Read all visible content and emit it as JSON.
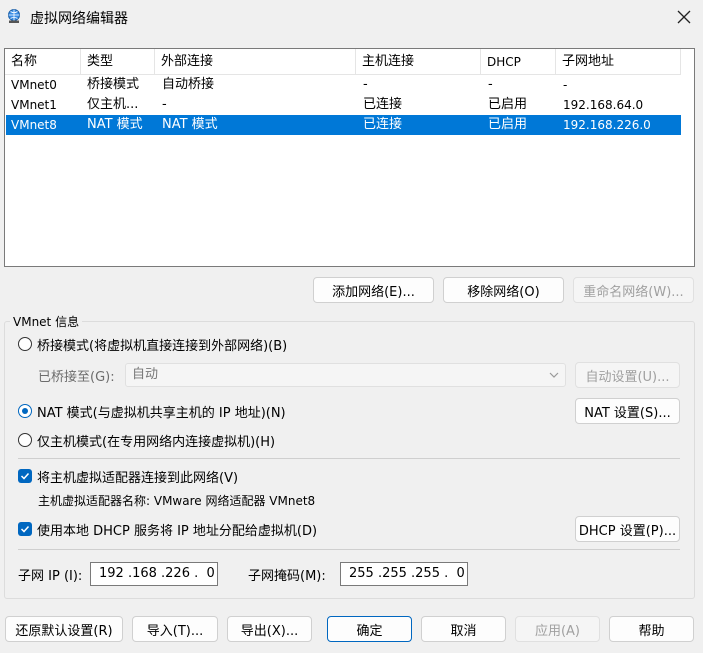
{
  "window": {
    "title": "虚拟网络编辑器",
    "icon": "network-globe-icon",
    "close_icon": "close-icon"
  },
  "table": {
    "columns": [
      "名称",
      "类型",
      "外部连接",
      "主机连接",
      "DHCP",
      "子网地址"
    ],
    "rows": [
      {
        "name": "VMnet0",
        "type": "桥接模式",
        "external": "自动桥接",
        "host": "-",
        "dhcp": "-",
        "subnet": "-",
        "selected": false
      },
      {
        "name": "VMnet1",
        "type": "仅主机...",
        "external": "-",
        "host": "已连接",
        "dhcp": "已启用",
        "subnet": "192.168.64.0",
        "selected": false
      },
      {
        "name": "VMnet8",
        "type": "NAT 模式",
        "external": "NAT 模式",
        "host": "已连接",
        "dhcp": "已启用",
        "subnet": "192.168.226.0",
        "selected": true
      }
    ]
  },
  "table_buttons": {
    "add": "添加网络(E)...",
    "remove": "移除网络(O)",
    "rename": "重命名网络(W)..."
  },
  "info": {
    "group_title": "VMnet 信息",
    "bridge_mode": "桥接模式(将虚拟机直接连接到外部网络)(B)",
    "bridged_to_label": "已桥接至(G):",
    "bridged_to_value": "自动",
    "auto_settings": "自动设置(U)...",
    "nat_mode": "NAT 模式(与虚拟机共享主机的 IP 地址)(N)",
    "nat_settings": "NAT 设置(S)...",
    "host_only": "仅主机模式(在专用网络内连接虚拟机)(H)",
    "connect_adapter": "将主机虚拟适配器连接到此网络(V)",
    "adapter_name": "主机虚拟适配器名称: VMware 网络适配器 VMnet8",
    "use_dhcp": "使用本地 DHCP 服务将 IP 地址分配给虚拟机(D)",
    "dhcp_settings": "DHCP 设置(P)...",
    "subnet_ip_label": "子网 IP (I):",
    "subnet_ip_value": "192 .168 .226 .  0",
    "subnet_mask_label": "子网掩码(M):",
    "subnet_mask_value": "255 .255 .255 .  0",
    "selected_mode": "nat",
    "connect_adapter_checked": true,
    "use_dhcp_checked": true
  },
  "footer": {
    "restore": "还原默认设置(R)",
    "import": "导入(T)...",
    "export": "导出(X)...",
    "ok": "确定",
    "cancel": "取消",
    "apply": "应用(A)",
    "help": "帮助"
  },
  "colors": {
    "accent": "#0067c0",
    "selection": "#0078d7"
  }
}
